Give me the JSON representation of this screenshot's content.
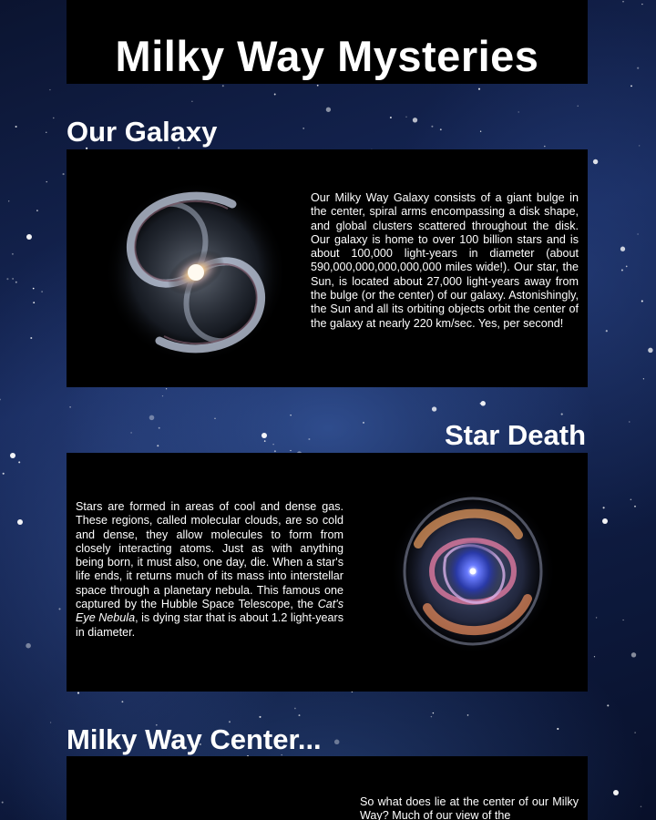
{
  "page": {
    "title": "Milky Way Mysteries"
  },
  "sections": [
    {
      "heading": "Our Galaxy",
      "text": "Our Milky Way Galaxy consists of a giant bulge in the center, spiral arms encompassing a disk shape, and global clusters scattered throughout the disk. Our galaxy is home to over 100 billion stars and is about 100,000 light-years in diameter (about 590,000,000,000,000,000 miles wide!). Our star, the Sun, is located about 27,000 light-years away from the bulge (or the center) of our galaxy. Astonishingly, the Sun and all its orbiting objects orbit the center of the galaxy at nearly 220 km/sec. Yes, per second!"
    },
    {
      "heading": "Star Death",
      "text_before": "Stars are formed in areas of cool and dense gas. These regions, called molecular clouds, are so cold and dense, they allow molecules to form from closely interacting atoms. Just as with anything being born, it must also, one day, die. When a star's life ends, it returns much of its mass into interstellar space through a planetary nebula. This famous one captured by the Hubble Space Telescope, the ",
      "text_italic": "Cat's Eye Nebula",
      "text_after": ", is dying star that is about 1.2 light-years in diameter."
    },
    {
      "heading": "Milky Way Center...",
      "text": "So what does lie at the center of our Milky Way? Much of our view of the"
    }
  ],
  "images": {
    "galaxy": "spiral-galaxy-image",
    "nebula": "cats-eye-nebula-image"
  },
  "colors": {
    "panel": "#000000",
    "text": "#ffffff",
    "space_bg": "#16285a"
  }
}
